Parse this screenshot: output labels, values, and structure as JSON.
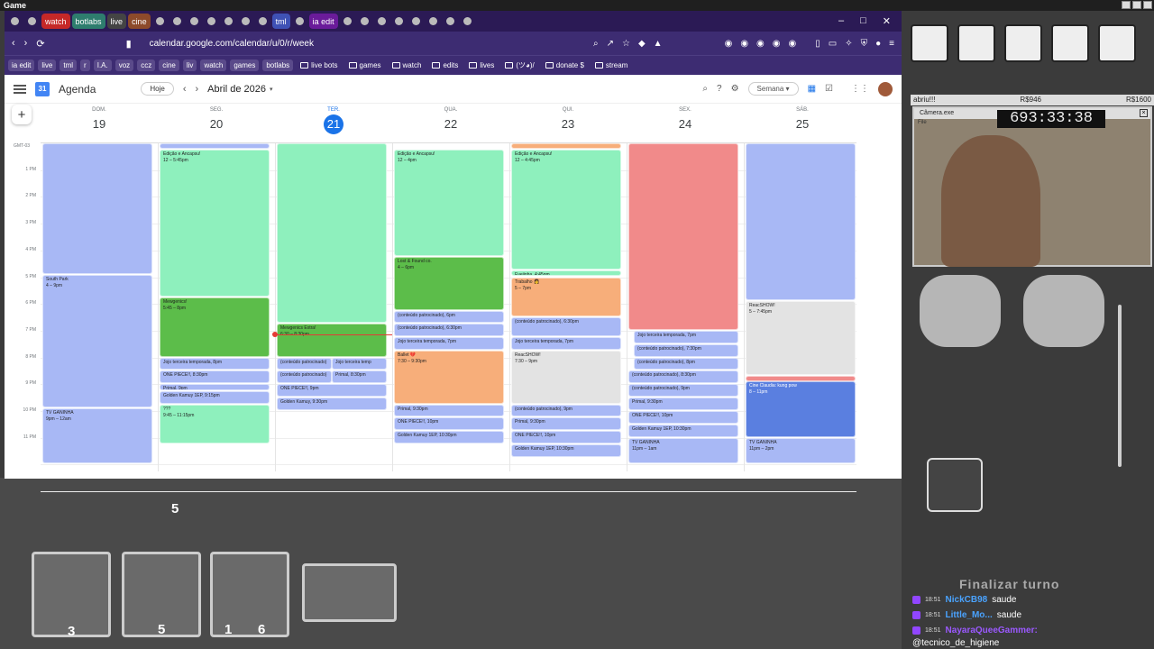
{
  "window": {
    "title": "Game"
  },
  "tabs": [
    {
      "label": "",
      "type": "dot"
    },
    {
      "label": "",
      "type": "dot"
    },
    {
      "label": "watch",
      "type": "label",
      "color": "#c62828"
    },
    {
      "label": "botlabs",
      "type": "label",
      "color": "#2e7d6e"
    },
    {
      "label": "live",
      "type": "label",
      "color": "#444444"
    },
    {
      "label": "cine",
      "type": "label",
      "color": "#8d4a2a"
    },
    {
      "label": "",
      "type": "dot"
    },
    {
      "label": "",
      "type": "dot"
    },
    {
      "label": "",
      "type": "dot"
    },
    {
      "label": "",
      "type": "dot"
    },
    {
      "label": "",
      "type": "dot"
    },
    {
      "label": "",
      "type": "dot"
    },
    {
      "label": "",
      "type": "dot"
    },
    {
      "label": "tml",
      "type": "label",
      "color": "#3f51b5"
    },
    {
      "label": "",
      "type": "dot"
    },
    {
      "label": "ia edit",
      "type": "label",
      "color": "#6a1b9a"
    },
    {
      "label": "",
      "type": "dot"
    },
    {
      "label": "",
      "type": "dot"
    },
    {
      "label": "",
      "type": "dot"
    },
    {
      "label": "",
      "type": "dot"
    },
    {
      "label": "",
      "type": "dot"
    },
    {
      "label": "",
      "type": "dot"
    },
    {
      "label": "",
      "type": "dot"
    },
    {
      "label": "",
      "type": "dot"
    }
  ],
  "address": {
    "url": "calendar.google.com/calendar/u/0/r/week"
  },
  "bookmarks": [
    {
      "label": "ia edit",
      "style": "pill"
    },
    {
      "label": "live",
      "style": "pill"
    },
    {
      "label": "tml",
      "style": "pill"
    },
    {
      "label": "r",
      "style": "pill"
    },
    {
      "label": "I.A.",
      "style": "pill"
    },
    {
      "label": "voz",
      "style": "pill"
    },
    {
      "label": "ccz",
      "style": "pill"
    },
    {
      "label": "cine",
      "style": "pill"
    },
    {
      "label": "liv",
      "style": "pill"
    },
    {
      "label": "watch",
      "style": "pill"
    },
    {
      "label": "games",
      "style": "pill"
    },
    {
      "label": "botlabs",
      "style": "pill"
    },
    {
      "label": "live bots",
      "style": "folder"
    },
    {
      "label": "games",
      "style": "folder"
    },
    {
      "label": "watch",
      "style": "folder"
    },
    {
      "label": "edits",
      "style": "folder"
    },
    {
      "label": "lives",
      "style": "folder"
    },
    {
      "label": "(ツ◕)/",
      "style": "folder"
    },
    {
      "label": "donate $",
      "style": "folder"
    },
    {
      "label": "stream",
      "style": "folder"
    }
  ],
  "calendar": {
    "app_name": "Agenda",
    "logo_day": "31",
    "today_button": "Hoje",
    "month": "Abril de 2026",
    "view": "Semana",
    "timezone": "GMT-03",
    "days": [
      {
        "weekday": "DOM.",
        "num": "19"
      },
      {
        "weekday": "SEG.",
        "num": "20"
      },
      {
        "weekday": "TER.",
        "num": "21",
        "today": true
      },
      {
        "weekday": "QUA.",
        "num": "22"
      },
      {
        "weekday": "QUI.",
        "num": "23"
      },
      {
        "weekday": "SEX.",
        "num": "24"
      },
      {
        "weekday": "SÁB.",
        "num": "25"
      }
    ],
    "hours": [
      "1 PM",
      "2 PM",
      "3 PM",
      "4 PM",
      "5 PM",
      "6 PM",
      "7 PM",
      "8 PM",
      "9 PM",
      "10 PM",
      "11 PM"
    ],
    "colors": {
      "blue": "#a8b8f5",
      "mint": "#8ef0bd",
      "green": "#5cbd4a",
      "orange": "#f7ae7a",
      "red": "#f18a8a",
      "gray": "#e3e3e3",
      "darkblue": "#5a7fe0",
      "today": "#1a73e8",
      "now": "#e53935"
    },
    "events": [
      {
        "day": 0,
        "start": 12.0,
        "end": 16.9,
        "title": "",
        "time": "",
        "color": "blue"
      },
      {
        "day": 0,
        "start": 16.9,
        "end": 21.9,
        "title": "South Park",
        "time": "4 – 9pm",
        "color": "blue"
      },
      {
        "day": 0,
        "start": 21.9,
        "end": 24.0,
        "title": "TV GANINHA",
        "time": "9pm – 12am",
        "color": "blue"
      },
      {
        "day": 1,
        "start": 12.0,
        "end": 12.25,
        "title": "",
        "time": "",
        "color": "blue"
      },
      {
        "day": 1,
        "start": 12.25,
        "end": 17.75,
        "title": "Edição e Ancapsu!",
        "time": "12 – 5:45pm",
        "color": "mint"
      },
      {
        "day": 1,
        "start": 17.75,
        "end": 20.0,
        "title": "Mewgenics!",
        "time": "5:45 – 8pm",
        "color": "green"
      },
      {
        "day": 1,
        "start": 20.0,
        "end": 20.5,
        "title": "Jojo terceira temporada, 8pm",
        "time": "",
        "color": "blue"
      },
      {
        "day": 1,
        "start": 20.5,
        "end": 21.0,
        "title": "ONE PIECE!!, 8:30pm",
        "time": "",
        "color": "blue"
      },
      {
        "day": 1,
        "start": 21.0,
        "end": 21.25,
        "title": "Primal, 9pm",
        "time": "",
        "color": "blue"
      },
      {
        "day": 1,
        "start": 21.25,
        "end": 21.75,
        "title": "Golden Kamuy 1EP, 9:15pm",
        "time": "",
        "color": "blue"
      },
      {
        "day": 1,
        "start": 21.75,
        "end": 23.25,
        "title": "???",
        "time": "9:45 – 11:15pm",
        "color": "mint"
      },
      {
        "day": 2,
        "start": 12.0,
        "end": 18.75,
        "title": "",
        "time": "",
        "color": "mint"
      },
      {
        "day": 2,
        "start": 18.75,
        "end": 20.0,
        "title": "Mewgenics Extra!",
        "time": "6:30 – 8:30pm",
        "color": "green"
      },
      {
        "day": 2,
        "start": 20.0,
        "end": 20.5,
        "title": "(conteúdo patrocinado)",
        "time": "",
        "color": "blue",
        "half": "left"
      },
      {
        "day": 2,
        "start": 20.0,
        "end": 20.5,
        "title": "Jojo terceira temp",
        "time": "",
        "color": "blue",
        "half": "right"
      },
      {
        "day": 2,
        "start": 20.5,
        "end": 21.0,
        "title": "(conteúdo patrocinado)",
        "time": "",
        "color": "blue",
        "half": "left"
      },
      {
        "day": 2,
        "start": 20.5,
        "end": 21.0,
        "title": "Primal, 8:30pm",
        "time": "",
        "color": "blue",
        "half": "right"
      },
      {
        "day": 2,
        "start": 21.0,
        "end": 21.5,
        "title": "ONE PIECE!!, 9pm",
        "time": "",
        "color": "blue"
      },
      {
        "day": 2,
        "start": 21.5,
        "end": 22.0,
        "title": "Golden Kamuy, 9:30pm",
        "time": "",
        "color": "blue"
      },
      {
        "day": 3,
        "start": 12.25,
        "end": 16.25,
        "title": "Edição e Ancapsu!",
        "time": "12 – 4pm",
        "color": "mint"
      },
      {
        "day": 3,
        "start": 16.25,
        "end": 18.25,
        "title": "Lost & Found co.",
        "time": "4 – 6pm",
        "color": "green"
      },
      {
        "day": 3,
        "start": 18.25,
        "end": 18.75,
        "title": "(conteúdo patrocinado), 6pm",
        "time": "",
        "color": "blue"
      },
      {
        "day": 3,
        "start": 18.75,
        "end": 19.25,
        "title": "(conteúdo patrocinado), 6:30pm",
        "time": "",
        "color": "blue"
      },
      {
        "day": 3,
        "start": 19.25,
        "end": 19.75,
        "title": "Jojo terceira temporada, 7pm",
        "time": "",
        "color": "blue"
      },
      {
        "day": 3,
        "start": 19.75,
        "end": 21.75,
        "title": "Ballet 💔",
        "time": "7:30 – 9:30pm",
        "color": "orange"
      },
      {
        "day": 3,
        "start": 21.75,
        "end": 22.25,
        "title": "Primal, 9:30pm",
        "time": "",
        "color": "blue"
      },
      {
        "day": 3,
        "start": 22.25,
        "end": 22.75,
        "title": "ONE PIECE!!, 10pm",
        "time": "",
        "color": "blue"
      },
      {
        "day": 3,
        "start": 22.75,
        "end": 23.25,
        "title": "Golden Kamuy 1EP, 10:30pm",
        "time": "",
        "color": "blue"
      },
      {
        "day": 4,
        "start": 12.0,
        "end": 12.25,
        "title": "",
        "time": "",
        "color": "orange"
      },
      {
        "day": 4,
        "start": 12.25,
        "end": 16.75,
        "title": "Edição e Ancapsu!",
        "time": "12 – 4:45pm",
        "color": "mint"
      },
      {
        "day": 4,
        "start": 16.75,
        "end": 17.0,
        "title": "Eveiinha, 4:45pm",
        "time": "",
        "color": "mint"
      },
      {
        "day": 4,
        "start": 17.0,
        "end": 18.5,
        "title": "Trabalho 👩",
        "time": "5 – 7pm",
        "color": "orange"
      },
      {
        "day": 4,
        "start": 18.5,
        "end": 19.25,
        "title": "(conteúdo patrocinado), 6:30pm",
        "time": "",
        "color": "blue"
      },
      {
        "day": 4,
        "start": 19.25,
        "end": 19.75,
        "title": "Jojo terceira temporada, 7pm",
        "time": "",
        "color": "blue"
      },
      {
        "day": 4,
        "start": 19.75,
        "end": 21.75,
        "title": "ReacSHOW!",
        "time": "7:30 – 9pm",
        "color": "gray"
      },
      {
        "day": 4,
        "start": 21.75,
        "end": 22.25,
        "title": "(conteúdo patrocinado), 9pm",
        "time": "",
        "color": "blue"
      },
      {
        "day": 4,
        "start": 22.25,
        "end": 22.75,
        "title": "Primal, 9:30pm",
        "time": "",
        "color": "blue"
      },
      {
        "day": 4,
        "start": 22.75,
        "end": 23.25,
        "title": "ONE PIECE!!, 10pm",
        "time": "",
        "color": "blue"
      },
      {
        "day": 4,
        "start": 23.25,
        "end": 23.75,
        "title": "Golden Kamuy 1EP, 10:30pm",
        "time": "",
        "color": "blue"
      },
      {
        "day": 5,
        "start": 12.0,
        "end": 19.0,
        "title": "",
        "time": "",
        "color": "red"
      },
      {
        "day": 5,
        "start": 19.0,
        "end": 19.5,
        "title": "Jojo terceira temporada, 7pm",
        "time": "",
        "color": "blue",
        "indent": true
      },
      {
        "day": 5,
        "start": 19.5,
        "end": 20.0,
        "title": "(conteúdo patrocinado), 7:30pm",
        "time": "",
        "color": "blue",
        "indent": true
      },
      {
        "day": 5,
        "start": 20.0,
        "end": 20.5,
        "title": "(conteúdo patrocinado), 8pm",
        "time": "",
        "color": "blue",
        "indent": true
      },
      {
        "day": 5,
        "start": 20.5,
        "end": 21.0,
        "title": "(conteúdo patrocinado), 8:30pm",
        "time": "",
        "color": "blue"
      },
      {
        "day": 5,
        "start": 21.0,
        "end": 21.5,
        "title": "(conteúdo patrocinado), 9pm",
        "time": "",
        "color": "blue"
      },
      {
        "day": 5,
        "start": 21.5,
        "end": 22.0,
        "title": "Primal, 9:30pm",
        "time": "",
        "color": "blue"
      },
      {
        "day": 5,
        "start": 22.0,
        "end": 22.5,
        "title": "ONE PIECE!!, 10pm",
        "time": "",
        "color": "blue"
      },
      {
        "day": 5,
        "start": 22.5,
        "end": 23.0,
        "title": "Golden Kamuy 1EP, 10:30pm",
        "time": "",
        "color": "blue"
      },
      {
        "day": 5,
        "start": 23.0,
        "end": 24.0,
        "title": "TV GANINHA",
        "time": "11pm – 1am",
        "color": "blue"
      },
      {
        "day": 6,
        "start": 12.0,
        "end": 17.9,
        "title": "",
        "time": "",
        "color": "blue"
      },
      {
        "day": 6,
        "start": 17.9,
        "end": 20.7,
        "title": "ReacSHOW!",
        "time": "5 – 7:45pm",
        "color": "gray"
      },
      {
        "day": 6,
        "start": 20.7,
        "end": 20.9,
        "title": "",
        "time": "",
        "color": "red"
      },
      {
        "day": 6,
        "start": 20.9,
        "end": 23.0,
        "title": "Cine Claudia: kung pow",
        "time": "8 – 11pm",
        "color": "darkblue"
      },
      {
        "day": 6,
        "start": 23.0,
        "end": 24.0,
        "title": "TV GANINHA",
        "time": "11pm – 2pm",
        "color": "blue"
      }
    ],
    "now_hour": 19.15
  },
  "overlay": {
    "donation": {
      "name": "abriu!!!",
      "amount1": "R$946",
      "amount2": "R$1600"
    },
    "camera": {
      "title": "Câmera.exe",
      "file": "File",
      "timer": "693:33:38"
    },
    "end_turn": "Finalizar turno",
    "card_badges": [
      "5",
      "3",
      "5",
      "1",
      "6"
    ],
    "chat": [
      {
        "time": "18:51",
        "user": "NickCB98",
        "message": "saude",
        "color": "#4aa3ff"
      },
      {
        "time": "18:51",
        "user": "Little_Mo...",
        "message": "saude",
        "color": "#4aa3ff"
      },
      {
        "time": "18:51",
        "user": "NayaraQueeGammer:",
        "message": "",
        "color": "#9b59ff"
      }
    ],
    "chat_last": "@tecnico_de_higiene"
  }
}
